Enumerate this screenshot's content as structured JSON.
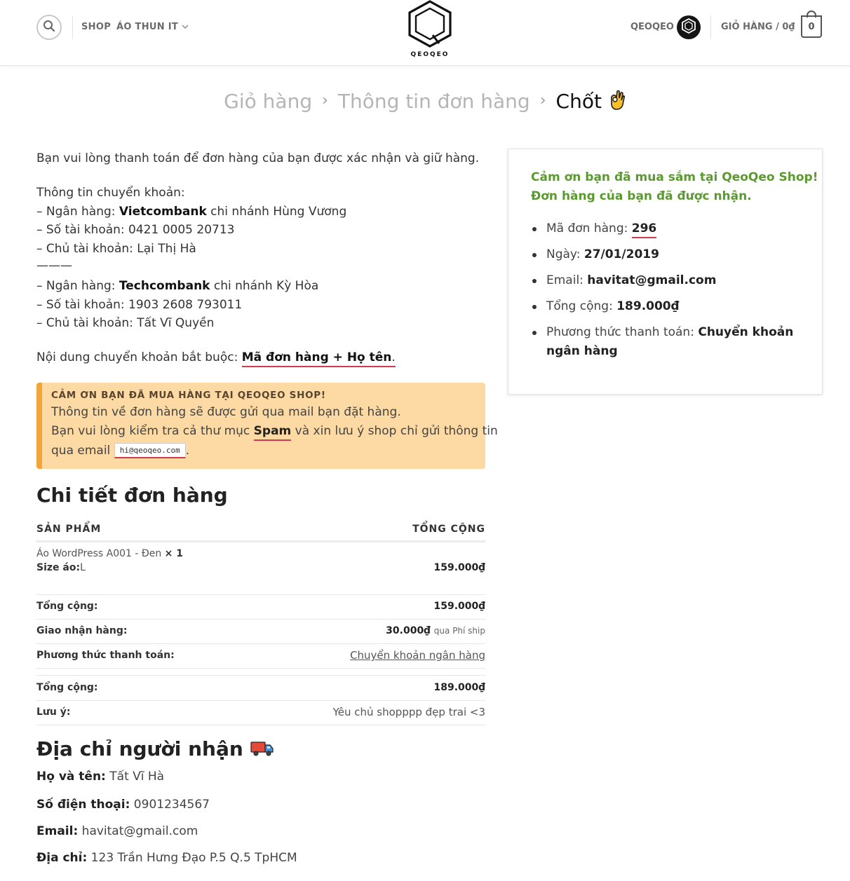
{
  "header": {
    "nav": [
      "SHOP",
      "ÁO THUN IT"
    ],
    "logo_text": "QEOQEO",
    "account_label": "QEOQEO",
    "cart_label": "GIỎ HÀNG / 0₫",
    "cart_count": "0"
  },
  "steps": {
    "cart": "Giỏ hàng",
    "info": "Thông tin đơn hàng",
    "done": "Chốt",
    "done_emoji": "👌"
  },
  "payment": {
    "intro": "Bạn vui lòng thanh toán để đơn hàng của bạn được xác nhận và giữ hàng.",
    "transfer_heading": "Thông tin chuyển khoản:",
    "bank1_prefix": "– Ngân hàng: ",
    "bank1_name": "Vietcombank",
    "bank1_branch": " chi nhánh Hùng Vương",
    "bank1_account": "– Số tài khoản: 0421 0005 20713",
    "bank1_owner": "– Chủ tài khoản: Lại Thị Hà",
    "separator": "———",
    "bank2_prefix": "– Ngân hàng: ",
    "bank2_name": "Techcombank",
    "bank2_branch": " chi nhánh Kỳ Hòa",
    "bank2_account": "– Số tài khoản: 1903 2608 793011",
    "bank2_owner": "– Chủ tài khoản: Tất Vĩ Quyền",
    "content_label": "Nội dung chuyển khoản bắt buộc: ",
    "content_value": "Mã đơn hàng + Họ tên",
    "content_end": "."
  },
  "notice": {
    "title": "CẢM ƠN BẠN ĐÃ MUA HÀNG TẠI QEOQEO SHOP!",
    "line1": "Thông tin về đơn hàng sẽ được gửi qua mail bạn đặt hàng.",
    "line2_a": "Bạn vui lòng kiểm tra cả thư mục ",
    "line2_spam": "Spam",
    "line2_b": " và xin lưu ý shop chỉ gửi thông tin",
    "line3_a": "qua email ",
    "email": "hi@qeoqeo.com",
    "line3_end": "."
  },
  "order_details": {
    "heading": "Chi tiết đơn hàng",
    "col_product": "SẢN PHẨM",
    "col_total": "TỔNG CỘNG",
    "item_name": "Áo WordPress A001 - Đen",
    "item_qty": "× 1",
    "item_meta_label": "Size áo:",
    "item_meta_value": "L",
    "item_total": "159.000₫",
    "rows": [
      {
        "label": "Tổng cộng:",
        "value": "159.000₫"
      },
      {
        "label": "Giao nhận hàng:",
        "value": "30.000₫",
        "note": "qua Phí ship"
      },
      {
        "label": "Phương thức thanh toán:",
        "value": "Chuyển khoản ngân hàng"
      },
      {
        "label": "Tổng cộng:",
        "value": "189.000₫"
      },
      {
        "label": "Lưu ý:",
        "value": "Yêu chủ shopppp đẹp trai <3"
      }
    ]
  },
  "address": {
    "heading": "Địa chỉ người nhận",
    "heading_emoji": "🚚",
    "name_label": "Họ và tên:",
    "name": " Tất Vĩ Hà",
    "phone_label": "Số điện thoại:",
    "phone": " 0901234567",
    "email_label": "Email:",
    "email": " havitat@gmail.com",
    "addr_label": "Địa chỉ:",
    "addr": " 123 Trần Hưng Đạo P.5 Q.5 TpHCM"
  },
  "summary": {
    "thanks_line1": "Cảm ơn bạn đã mua sắm tại QeoQeo Shop!",
    "thanks_line2": "Đơn hàng của bạn đã được nhận.",
    "order_label": "Mã đơn hàng: ",
    "order_number": "296",
    "date_label": "Ngày: ",
    "date": "27/01/2019",
    "email_label": "Email: ",
    "email": "havitat@gmail.com",
    "total_label": "Tổng cộng: ",
    "total": "189.000₫",
    "method_label": "Phương thức thanh toán: ",
    "method_line1": "Chuyển khoản",
    "method_line2": "ngân hàng"
  },
  "colors": {
    "accent_green": "#5a9a2f",
    "notice_bg": "#fdd9a3",
    "notice_border": "#f2a53a",
    "underline_red": "#d23a4e"
  }
}
